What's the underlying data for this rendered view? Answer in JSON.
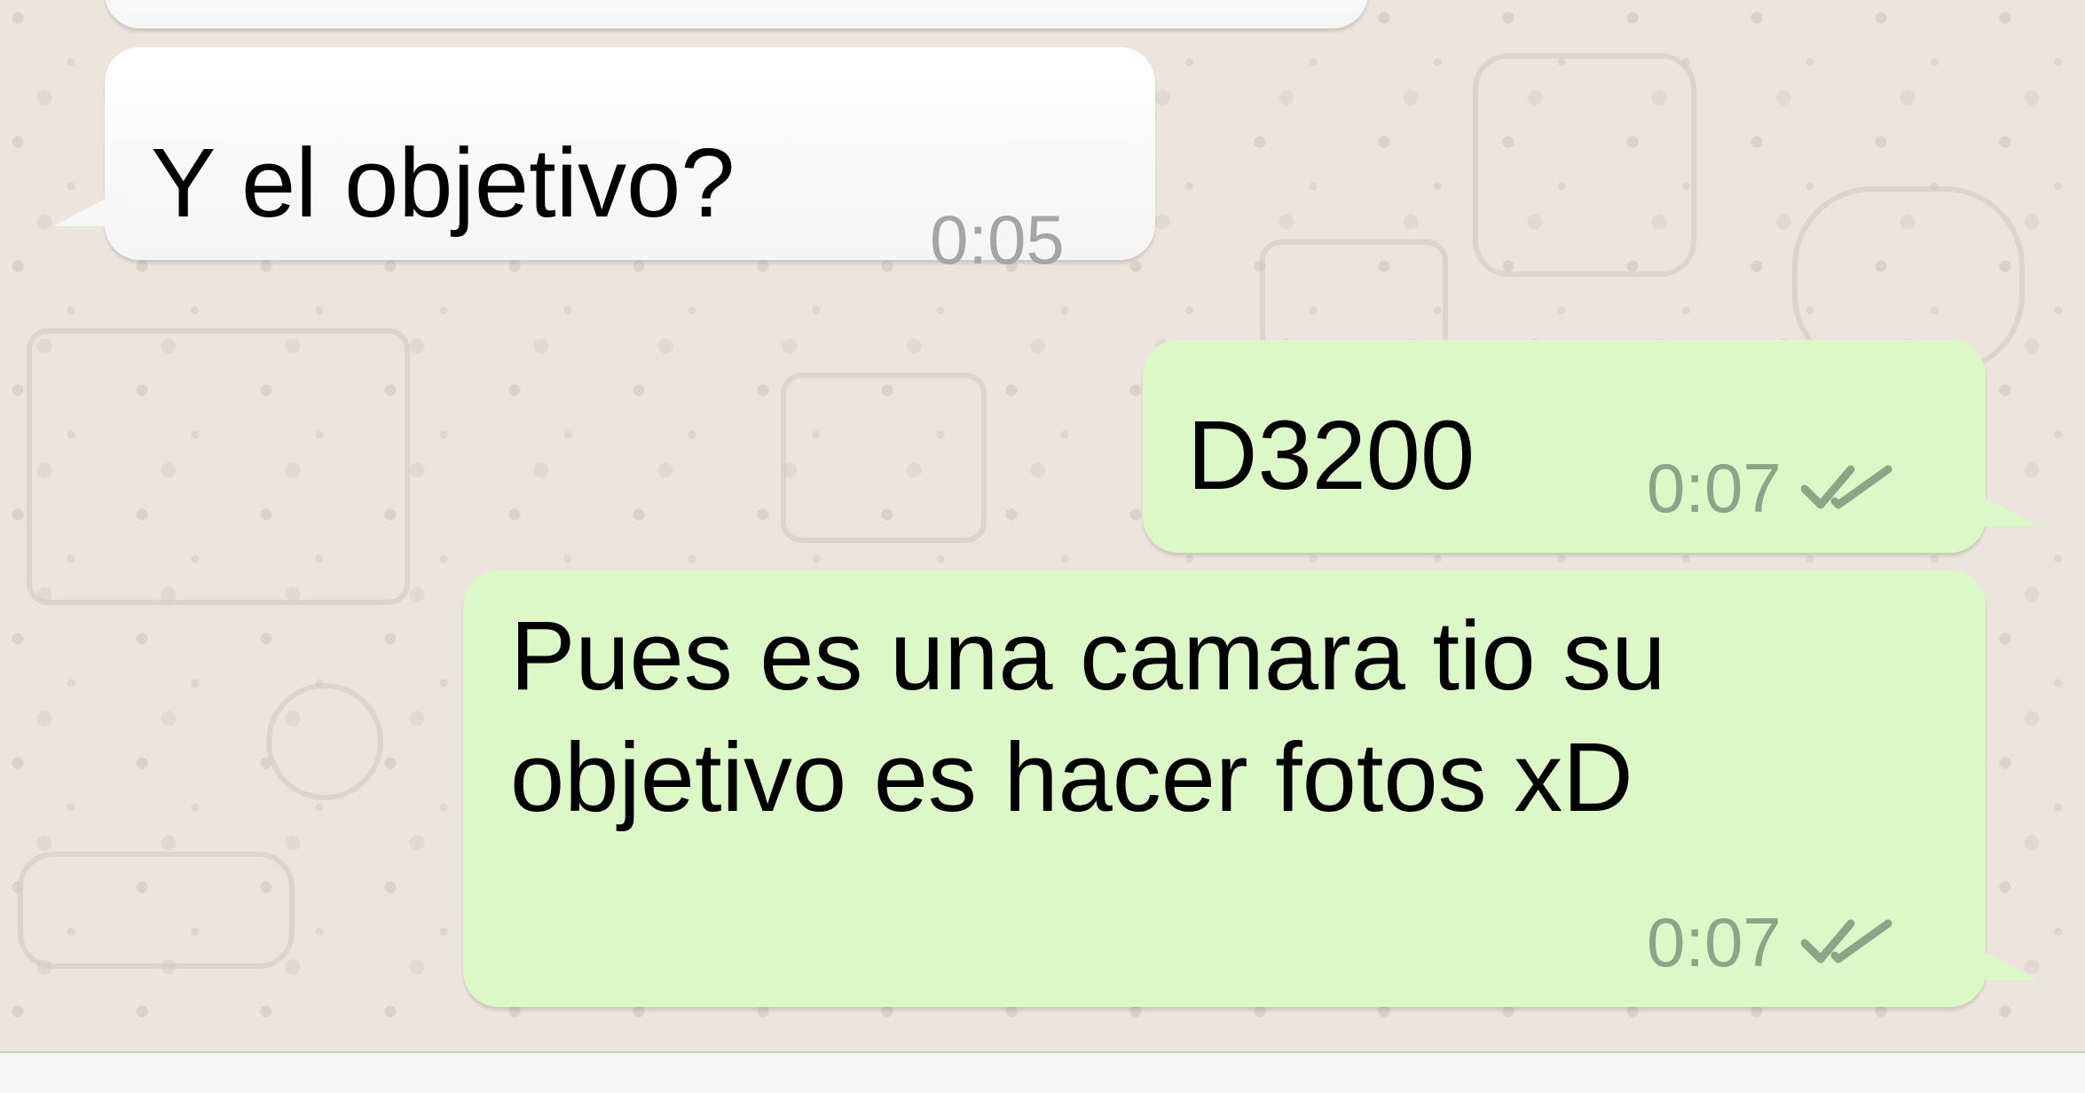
{
  "messages": [
    {
      "direction": "incoming",
      "text": "Y el objetivo?",
      "time": "0:05"
    },
    {
      "direction": "outgoing",
      "text": "D3200",
      "time": "0:07",
      "status": "read-ticks-icon"
    },
    {
      "direction": "outgoing",
      "text_lines": [
        "Pues es una camara tio su",
        "objetivo es hacer fotos xD"
      ],
      "time": "0:07",
      "status": "read-ticks-icon"
    }
  ],
  "colors": {
    "chat_background": "#ece5dd",
    "incoming_bubble": "#ffffff",
    "outgoing_bubble": "#dcf8c6",
    "tick_color": "#8ca488"
  }
}
